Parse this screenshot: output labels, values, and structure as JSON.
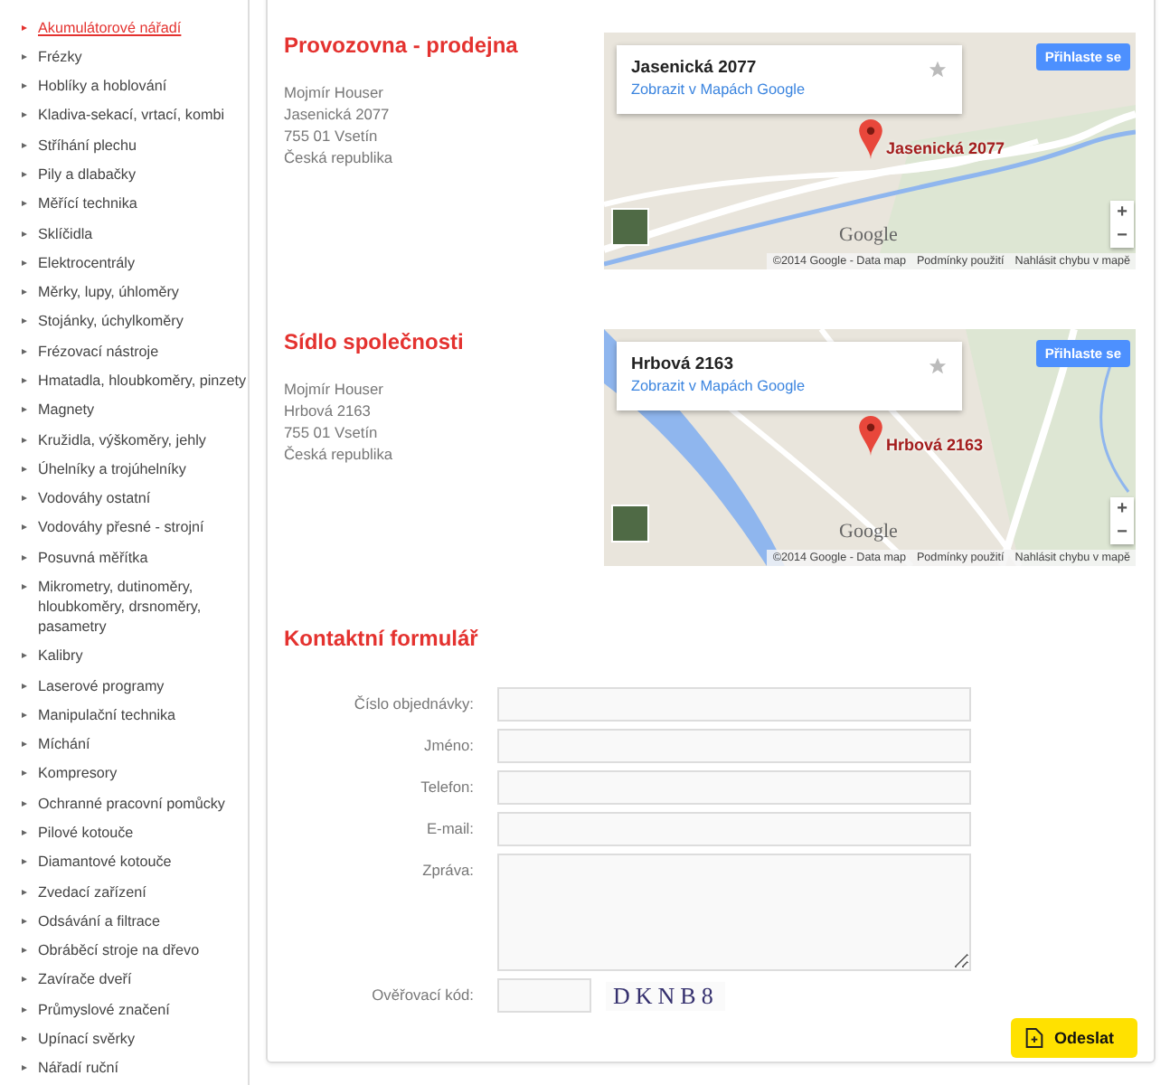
{
  "sidebar": {
    "items": [
      {
        "label": "Akumulátorové nářadí",
        "selected": true
      },
      {
        "label": "Frézky",
        "selected": false
      },
      {
        "label": "Hoblíky a hoblování",
        "selected": false
      },
      {
        "label": "Kladiva-sekací, vrtací, kombi",
        "selected": false
      },
      {
        "label": "Stříhání plechu",
        "selected": false
      },
      {
        "label": "Pily a dlabačky",
        "selected": false
      },
      {
        "label": "Měřící technika",
        "selected": false
      },
      {
        "label": "Sklíčidla",
        "selected": false
      },
      {
        "label": "Elektrocentrály",
        "selected": false
      },
      {
        "label": "Měrky, lupy, úhloměry",
        "selected": false
      },
      {
        "label": "Stojánky, úchylkoměry",
        "selected": false
      },
      {
        "label": "Frézovací nástroje",
        "selected": false
      },
      {
        "label": "Hmatadla, hloubkoměry, pinzety",
        "selected": false
      },
      {
        "label": "Magnety",
        "selected": false
      },
      {
        "label": "Kružidla, výškoměry, jehly",
        "selected": false
      },
      {
        "label": "Úhelníky a trojúhelníky",
        "selected": false
      },
      {
        "label": "Vodováhy ostatní",
        "selected": false
      },
      {
        "label": "Vodováhy přesné - strojní",
        "selected": false
      },
      {
        "label": "Posuvná měřítka",
        "selected": false
      },
      {
        "label": "Mikrometry, dutinoměry, hloubkoměry, drsnoměry, pasametry",
        "selected": false
      },
      {
        "label": "Kalibry",
        "selected": false
      },
      {
        "label": "Laserové programy",
        "selected": false
      },
      {
        "label": "Manipulační technika",
        "selected": false
      },
      {
        "label": "Míchání",
        "selected": false
      },
      {
        "label": "Kompresory",
        "selected": false
      },
      {
        "label": "Ochranné pracovní pomůcky",
        "selected": false
      },
      {
        "label": "Pilové kotouče",
        "selected": false
      },
      {
        "label": "Diamantové kotouče",
        "selected": false
      },
      {
        "label": "Zvedací zařízení",
        "selected": false
      },
      {
        "label": "Odsávání a filtrace",
        "selected": false
      },
      {
        "label": "Obráběcí stroje na dřevo",
        "selected": false
      },
      {
        "label": "Zavírače dveří",
        "selected": false
      },
      {
        "label": "Průmyslové značení",
        "selected": false
      },
      {
        "label": "Upínací svěrky",
        "selected": false
      },
      {
        "label": "Nářadí ruční",
        "selected": false
      }
    ]
  },
  "sections": [
    {
      "title": "Provozovna - prodejna",
      "address_lines": [
        "Mojmír Houser",
        "Jasenická 2077",
        "755 01 Vsetín",
        "Česká republika"
      ],
      "map": {
        "card_title": "Jasenická 2077",
        "card_link": "Zobrazit v Mapách Google",
        "signin": "Přihlaste se",
        "marker_label": "Jasenická 2077",
        "zoom_in": "+",
        "zoom_out": "−",
        "logo": "Google",
        "attribution": [
          "©2014 Google - Data map",
          "Podmínky použití",
          "Nahlásit chybu v mapě"
        ]
      }
    },
    {
      "title": "Sídlo společnosti",
      "address_lines": [
        "Mojmír Houser",
        "Hrbová 2163",
        "755 01 Vsetín",
        "Česká republika"
      ],
      "map": {
        "card_title": "Hrbová 2163",
        "card_link": "Zobrazit v Mapách Google",
        "signin": "Přihlaste se",
        "marker_label": "Hrbová 2163",
        "zoom_in": "+",
        "zoom_out": "−",
        "logo": "Google",
        "attribution": [
          "©2014 Google - Data map",
          "Podmínky použití",
          "Nahlásit chybu v mapě"
        ]
      }
    }
  ],
  "form": {
    "title": "Kontaktní formulář",
    "fields": [
      {
        "label": "Číslo objednávky:",
        "kind": "input"
      },
      {
        "label": "Jméno:",
        "kind": "input"
      },
      {
        "label": "Telefon:",
        "kind": "input"
      },
      {
        "label": "E-mail:",
        "kind": "input"
      },
      {
        "label": "Zpráva:",
        "kind": "textarea"
      }
    ],
    "captcha": {
      "label": "Ověřovací kód:",
      "code": "DKNB8"
    },
    "submit": "Odeslat"
  }
}
